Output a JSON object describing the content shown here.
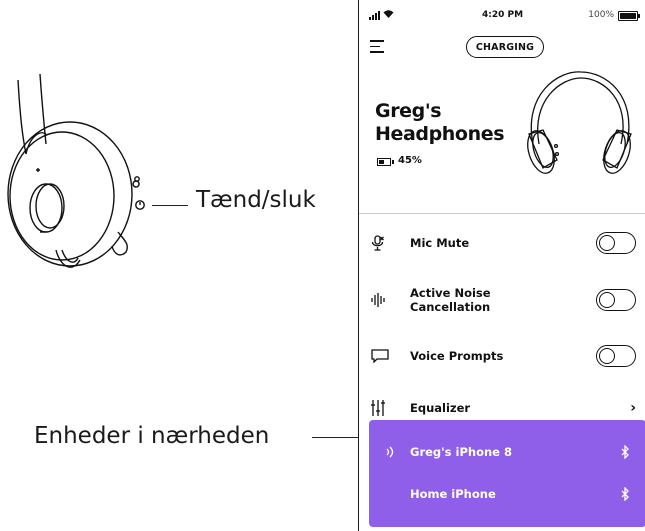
{
  "callouts": {
    "power": "Tænd/sluk",
    "nearby_devices": "Enheder i nærheden"
  },
  "statusbar": {
    "time": "4:20 PM",
    "battery_text": "100%"
  },
  "header": {
    "status_pill": "CHARGING"
  },
  "device": {
    "name": "Greg's Headphones",
    "battery": "45%"
  },
  "settings": [
    {
      "label": "Mic Mute",
      "control": "toggle",
      "on": false,
      "icon": "mic-mute-icon"
    },
    {
      "label": "Active Noise Cancellation",
      "control": "toggle",
      "on": false,
      "icon": "noise-cancellation-icon"
    },
    {
      "label": "Voice Prompts",
      "control": "toggle",
      "on": false,
      "icon": "voice-prompts-icon"
    },
    {
      "label": "Equalizer",
      "control": "chevron",
      "icon": "equalizer-icon"
    }
  ],
  "nearby_devices": [
    {
      "name": "Greg's iPhone 8",
      "active": true
    },
    {
      "name": "Home iPhone",
      "active": false
    }
  ],
  "colors": {
    "nearby_panel": "#8f5fea",
    "text": "#111111"
  }
}
